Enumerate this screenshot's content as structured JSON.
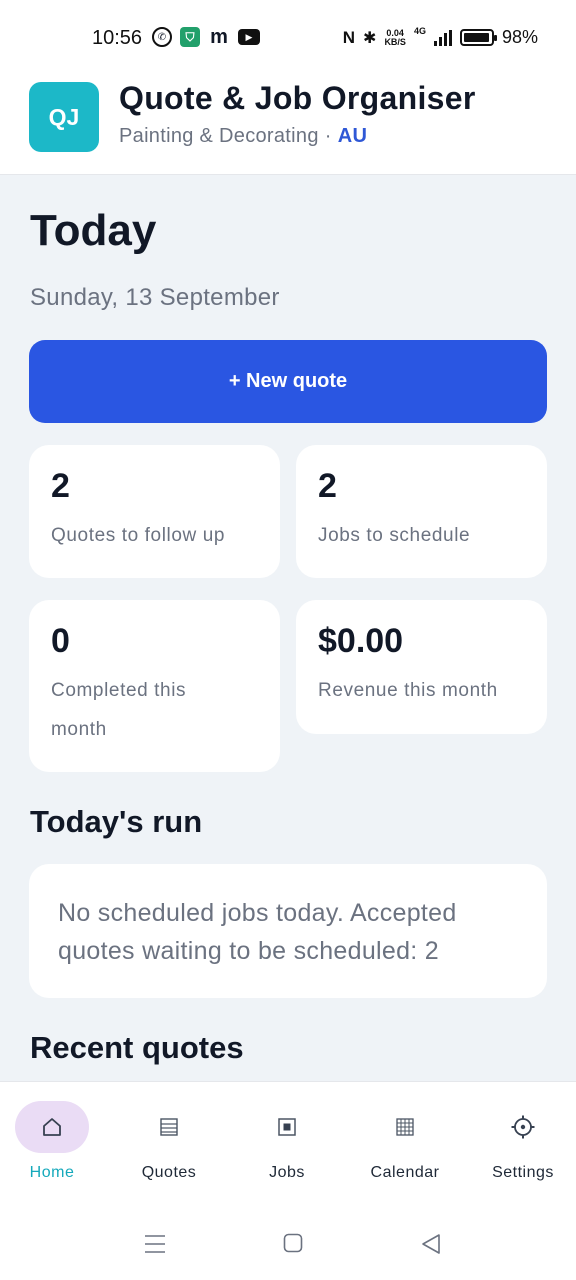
{
  "status_bar": {
    "time": "10:56",
    "net_speed_value": "0.04",
    "net_speed_unit": "KB/S",
    "network_type": "4G",
    "battery_percent": "98%",
    "battery_level": 0.98
  },
  "app": {
    "logo_text": "QJ",
    "title": "Quote & Job Organiser",
    "subtitle_trade": "Painting & Decorating",
    "subtitle_separator": "·",
    "subtitle_region": "AU"
  },
  "today": {
    "heading": "Today",
    "date": "Sunday, 13 September",
    "new_quote_label": "+ New quote"
  },
  "stats": [
    {
      "value": "2",
      "label": "Quotes to follow up"
    },
    {
      "value": "2",
      "label": "Jobs to schedule"
    },
    {
      "value": "0",
      "label": "Completed this month"
    },
    {
      "value": "$0.00",
      "label": "Revenue this month"
    }
  ],
  "todays_run": {
    "heading": "Today's run",
    "message": "No scheduled jobs today. Accepted quotes waiting to be scheduled: 2"
  },
  "recent_quotes": {
    "heading": "Recent quotes"
  },
  "bottom_nav": [
    {
      "label": "Home",
      "icon": "home-icon",
      "active": true
    },
    {
      "label": "Quotes",
      "icon": "list-icon",
      "active": false
    },
    {
      "label": "Jobs",
      "icon": "square-dot-icon",
      "active": false
    },
    {
      "label": "Calendar",
      "icon": "grid-icon",
      "active": false
    },
    {
      "label": "Settings",
      "icon": "gear-icon",
      "active": false
    }
  ],
  "colors": {
    "accent": "#2a56e2",
    "brand_teal": "#1cb8c8",
    "active_nav_label": "#15a9bb",
    "active_nav_pill": "#eadcf5",
    "background": "#eff3f7"
  }
}
